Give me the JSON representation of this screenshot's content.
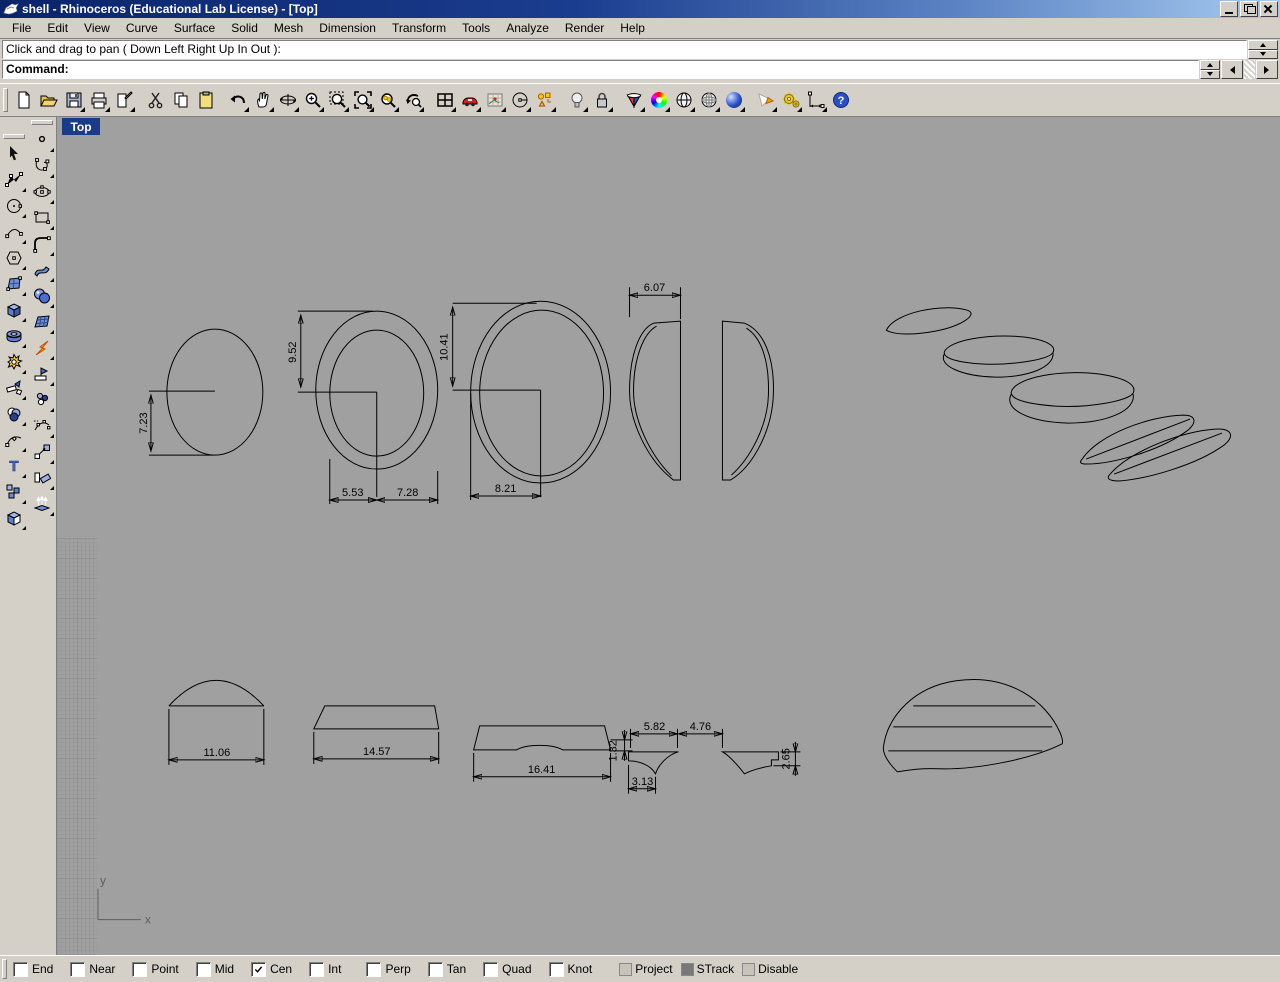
{
  "window": {
    "title": "shell - Rhinoceros (Educational Lab License) - [Top]",
    "app_icon": "rhino-logo"
  },
  "menu": {
    "items": [
      "File",
      "Edit",
      "View",
      "Curve",
      "Surface",
      "Solid",
      "Mesh",
      "Dimension",
      "Transform",
      "Tools",
      "Analyze",
      "Render",
      "Help"
    ]
  },
  "command": {
    "history_line": "Click and drag to pan ( Down  Left  Right  Up  In  Out ):",
    "prompt": "Command:"
  },
  "toolbar": {
    "icons": [
      "new-file",
      "open-file",
      "save",
      "print",
      "edit-page",
      "cut",
      "copy",
      "paste",
      "undo",
      "pan",
      "rotate-view",
      "zoom-in",
      "zoom-window",
      "zoom-extents",
      "zoom-selected",
      "undo-view",
      "viewport-layout",
      "named-views",
      "background-map",
      "cplane",
      "osnap",
      "lamp",
      "lock",
      "render-preview",
      "color-wheel",
      "shaded-sphere",
      "grid-sphere",
      "render-sphere",
      "spotlight",
      "options-gears",
      "dimension-tool",
      "help"
    ]
  },
  "sidebar": {
    "col1": [
      "select",
      "control-points",
      "circle",
      "arc",
      "polygon",
      "surface-patch",
      "box",
      "torus",
      "puzzle",
      "trim",
      "join",
      "curve-handle",
      "text",
      "group",
      "boolean"
    ],
    "col2": [
      "point",
      "curve-through-points",
      "ellipse",
      "rectangle",
      "fillet",
      "curved-surface",
      "sphere",
      "mesh-surface",
      "explode",
      "split",
      "point-cloud",
      "rebuild",
      "move",
      "copy-rotate",
      "extrude"
    ]
  },
  "viewport": {
    "tab": "Top",
    "axis": {
      "x": "x",
      "y": "y"
    },
    "dims": {
      "ellipse1_height": "7.23",
      "ellipse2_height": "9.52",
      "ellipse2_inner_width": "5.53",
      "ellipse2_outer_width": "7.28",
      "ellipse3_height": "10.41",
      "ellipse3_width": "8.21",
      "profile_width": "6.07",
      "dome_width": "11.06",
      "trapezoid_width": "14.57",
      "base_width": "16.41",
      "base_edge": "1.32",
      "notch_left_width": "5.82",
      "notch_gap": "4.76",
      "notch_bottom": "3.13",
      "notch_right_height": "2.65"
    }
  },
  "statusbar": {
    "snaps": [
      {
        "label": "End",
        "checked": false
      },
      {
        "label": "Near",
        "checked": false
      },
      {
        "label": "Point",
        "checked": false
      },
      {
        "label": "Mid",
        "checked": false
      },
      {
        "label": "Cen",
        "checked": true
      },
      {
        "label": "Int",
        "checked": false
      },
      {
        "label": "Perp",
        "checked": false
      },
      {
        "label": "Tan",
        "checked": false
      },
      {
        "label": "Quad",
        "checked": false
      },
      {
        "label": "Knot",
        "checked": false
      }
    ],
    "modes": [
      {
        "label": "Project",
        "active": false
      },
      {
        "label": "STrack",
        "active": true
      },
      {
        "label": "Disable",
        "active": false
      }
    ]
  },
  "glyphs": {
    "help": "?",
    "text_tool": "T"
  },
  "colors": {
    "titlebar_left": "#0a246a",
    "titlebar_right": "#a6caf0",
    "chrome": "#d4d0c8",
    "viewport_bg": "#a0a0a0",
    "active_tab": "#1a3a8a",
    "line": "#000000"
  }
}
